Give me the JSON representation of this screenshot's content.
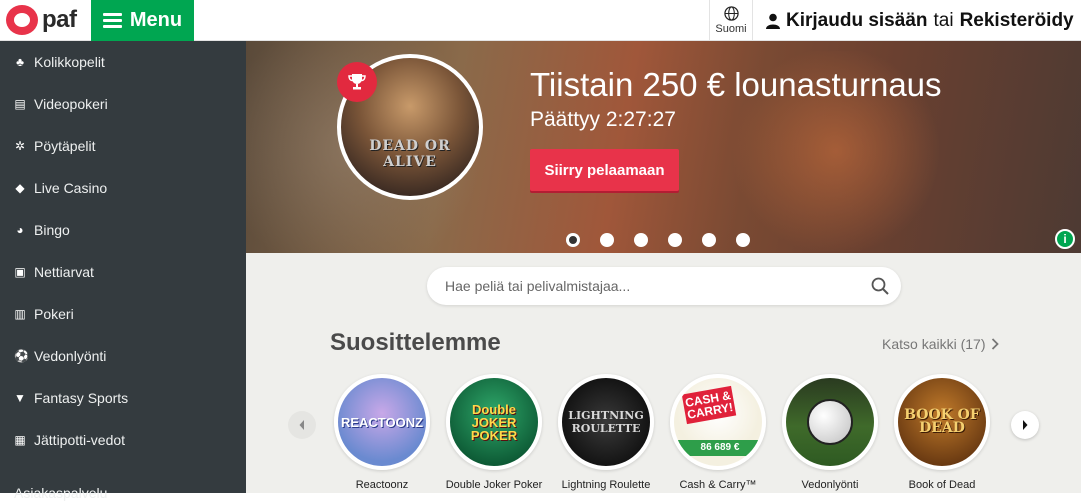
{
  "brand": {
    "logo_text": "paf",
    "accent": "#00a651",
    "red": "#e8334a"
  },
  "topbar": {
    "menu_label": "Menu",
    "language_label": "Suomi",
    "login_label": "Kirjaudu sisään",
    "or_label": "tai",
    "register_label": "Rekisteröidy"
  },
  "sidebar": {
    "items": [
      {
        "label": "Kolikkopelit",
        "icon": "slot-icon"
      },
      {
        "label": "Videopokeri",
        "icon": "cards-icon"
      },
      {
        "label": "Pöytäpelit",
        "icon": "chip-icon"
      },
      {
        "label": "Live Casino",
        "icon": "dice-icon"
      },
      {
        "label": "Bingo",
        "icon": "bingo-ball-icon"
      },
      {
        "label": "Nettiarvat",
        "icon": "ticket-icon"
      },
      {
        "label": "Pokeri",
        "icon": "poker-cards-icon"
      },
      {
        "label": "Vedonlyönti",
        "icon": "football-icon"
      },
      {
        "label": "Fantasy Sports",
        "icon": "jersey-icon"
      },
      {
        "label": "Jättipotti-vedot",
        "icon": "jackpot-ticket-icon"
      }
    ],
    "partial_label": "Asiakaspalvelu"
  },
  "hero": {
    "game_name": "DEAD OR ALIVE",
    "title": "Tiistain 250 € lounasturnaus",
    "subtitle": "Päättyy 2:27:27",
    "cta_label": "Siirry pelaamaan",
    "slides": 6,
    "active_slide": 1,
    "info_label": "i"
  },
  "search": {
    "placeholder": "Hae peliä tai pelivalmistajaa..."
  },
  "recommended": {
    "title": "Suosittelemme",
    "see_all_label": "Katso kaikki (17)",
    "games": [
      {
        "name": "Reactoonz",
        "art_text": "REACTOONZ"
      },
      {
        "name": "Double Joker Poker",
        "art_text": "Double JOKER POKER"
      },
      {
        "name": "Lightning Roulette",
        "art_text": "LIGHTNING ROULETTE"
      },
      {
        "name": "Cash & Carry™",
        "art_text": "CASH & CARRY!",
        "amount": "86 689 €"
      },
      {
        "name": "Vedonlyönti",
        "art_text": ""
      },
      {
        "name": "Book of Dead",
        "art_text": "BOOK OF DEAD"
      }
    ]
  }
}
